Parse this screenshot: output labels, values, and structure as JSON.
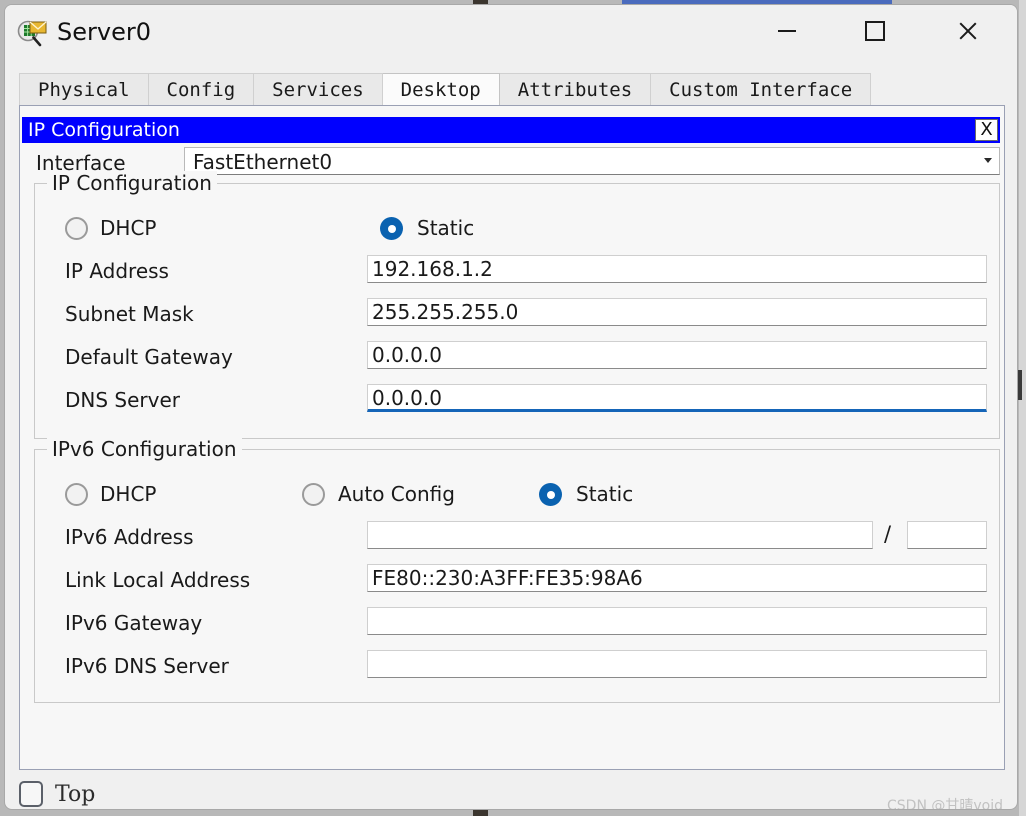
{
  "window": {
    "title": "Server0",
    "icon": "server-magnifier-icon",
    "controls": {
      "minimize": "—",
      "maximize": "☐",
      "close": "✕"
    }
  },
  "tabs": [
    {
      "label": "Physical",
      "active": false
    },
    {
      "label": "Config",
      "active": false
    },
    {
      "label": "Services",
      "active": false
    },
    {
      "label": "Desktop",
      "active": true
    },
    {
      "label": "Attributes",
      "active": false
    },
    {
      "label": "Custom Interface",
      "active": false
    }
  ],
  "dialog": {
    "title": "IP Configuration",
    "close_label": "X",
    "titlebar_color": "#0000ff",
    "interface": {
      "label": "Interface",
      "value": "FastEthernet0"
    },
    "ipv4": {
      "legend": "IP Configuration",
      "dhcp_label": "DHCP",
      "dhcp_selected": false,
      "static_label": "Static",
      "static_selected": true,
      "fields": [
        {
          "label": "IP Address",
          "value": "192.168.1.2",
          "focused": false
        },
        {
          "label": "Subnet Mask",
          "value": "255.255.255.0",
          "focused": false
        },
        {
          "label": "Default Gateway",
          "value": "0.0.0.0",
          "focused": false
        },
        {
          "label": "DNS Server",
          "value": "0.0.0.0",
          "focused": true
        }
      ]
    },
    "ipv6": {
      "legend": "IPv6 Configuration",
      "dhcp_label": "DHCP",
      "dhcp_selected": false,
      "auto_label": "Auto Config",
      "auto_selected": false,
      "static_label": "Static",
      "static_selected": true,
      "address_label": "IPv6 Address",
      "address_value": "",
      "prefix_separator": "/",
      "prefix_value": "",
      "fields": [
        {
          "label": "Link Local Address",
          "value": "FE80::230:A3FF:FE35:98A6"
        },
        {
          "label": "IPv6 Gateway",
          "value": ""
        },
        {
          "label": "IPv6 DNS Server",
          "value": ""
        }
      ]
    }
  },
  "footer": {
    "top_label": "Top",
    "top_checked": false,
    "watermark": "CSDN @甘晴void"
  },
  "colors": {
    "accent_radio": "#0a62b0",
    "focus_underline": "#1565b8",
    "dialog_title_bg": "#0000ff"
  }
}
